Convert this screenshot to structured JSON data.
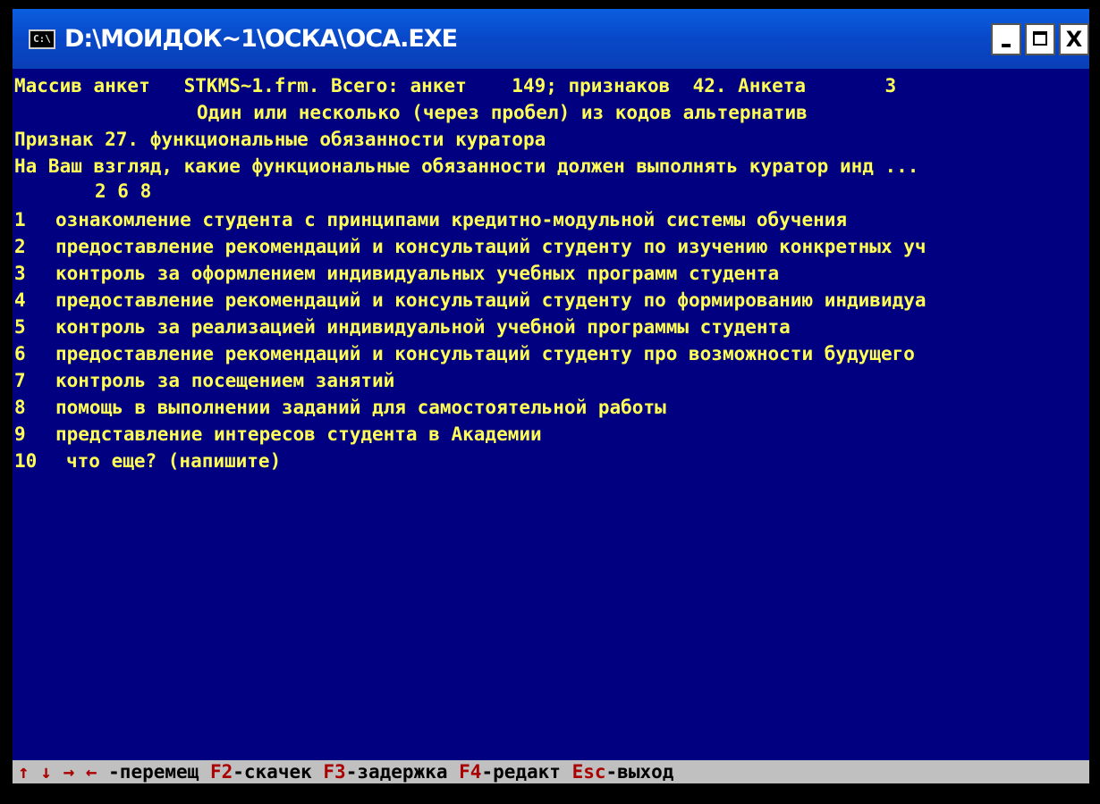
{
  "window": {
    "title": "D:\\МОИДОК~1\\ОСКА\\ОСА.EXE",
    "icon_label": "C:\\",
    "minimize_label": "",
    "maximize_label": "",
    "close_label": "X"
  },
  "console": {
    "header_line": "Массив анкет   STKMS~1.frm. Всего: анкет    149; признаков  42. Анкета       3",
    "instruction_line": "Один или несколько (через пробел) из кодов альтернатив",
    "feature_line": "Признак 27. функциональные обязанности куратора",
    "question_line": "На Ваш взгляд, какие функциональные обязанности должен выполнять куратор инд ...",
    "answer_line": "2 6 8",
    "options": [
      {
        "code": "1",
        "text": "ознакомление студента с принципами кредитно-модульной системы обучения"
      },
      {
        "code": "2",
        "text": "предоставление рекомендаций и консультаций студенту по изучению конкретных уч"
      },
      {
        "code": "3",
        "text": "контроль за оформлением индивидуальных учебных программ студента"
      },
      {
        "code": "4",
        "text": "предоставление рекомендаций и консультаций студенту по формированию индивидуа"
      },
      {
        "code": "5",
        "text": "контроль за реализацией индивидуальной учебной программы студента"
      },
      {
        "code": "6",
        "text": "предоставление рекомендаций и консультаций студенту про возможности будущего"
      },
      {
        "code": "7",
        "text": "контроль за посещением занятий"
      },
      {
        "code": "8",
        "text": "помощь в выполнении заданий для самостоятельной работы"
      },
      {
        "code": "9",
        "text": "представление интересов студента в Академии"
      },
      {
        "code": "10",
        "text": "что еще? (напишите)"
      }
    ]
  },
  "statusbar": {
    "arrows": "↑ ↓ → ←",
    "move_label": " -перемещ ",
    "f2_key": "F2",
    "f2_label": "-скачек ",
    "f3_key": "F3",
    "f3_label": "-задержка ",
    "f4_key": "F4",
    "f4_label": "-редакт ",
    "esc_key": "Esc",
    "esc_label": "-выход"
  },
  "colors": {
    "console_bg": "#000080",
    "console_text": "#ffff55",
    "titlebar": "#0848c8",
    "status_key": "#aa0000"
  }
}
